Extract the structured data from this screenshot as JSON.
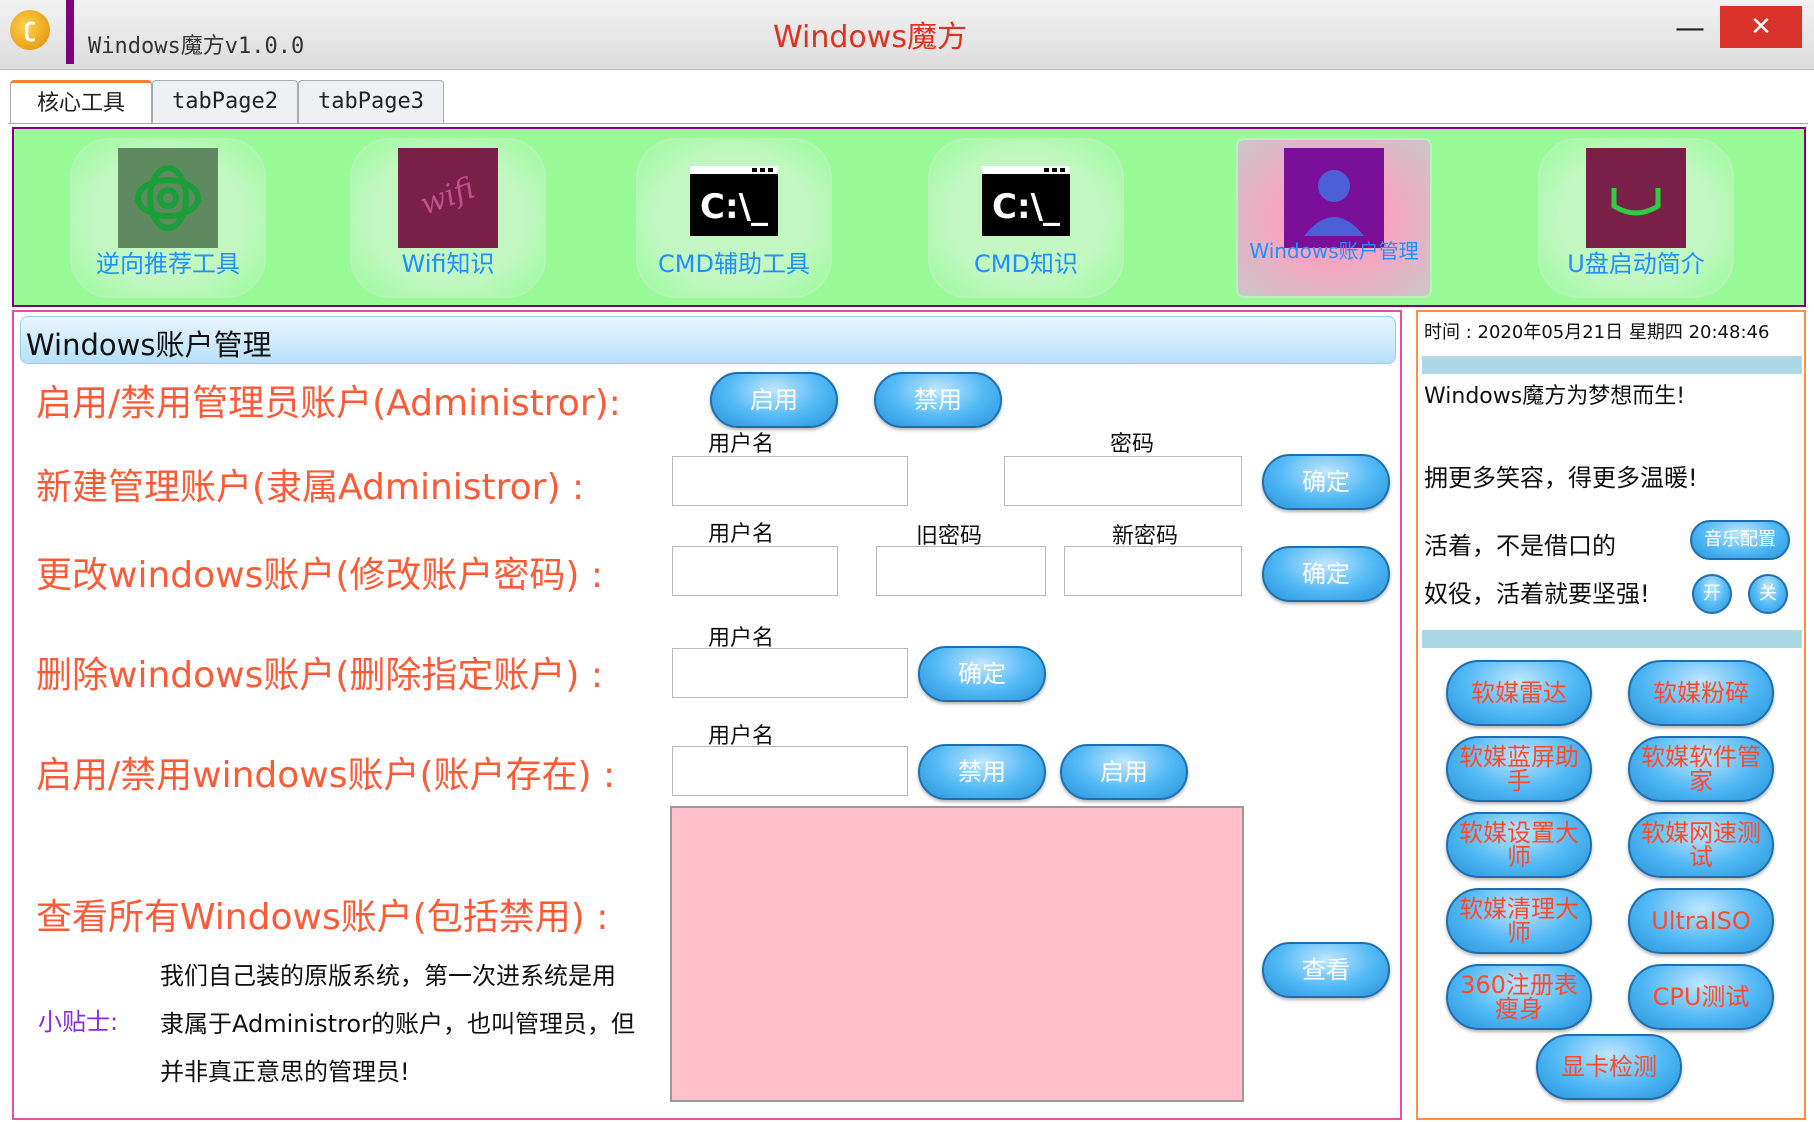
{
  "window": {
    "title_small": "Windows魔方v1.0.0",
    "title_center": "Windows魔方",
    "minimize": "—",
    "close": "✕"
  },
  "tabs": [
    "核心工具",
    "tabPage2",
    "tabPage3"
  ],
  "tools": [
    {
      "label": "逆向推荐工具",
      "icon": "reverse-icon"
    },
    {
      "label": "Wifi知识",
      "icon": "wifi-icon",
      "icon_text": "wifi"
    },
    {
      "label": "CMD辅助工具",
      "icon": "cmd-icon",
      "icon_text": "C:\\_"
    },
    {
      "label": "CMD知识",
      "icon": "cmd-icon",
      "icon_text": "C:\\_"
    },
    {
      "label": "Windows账户管理",
      "icon": "user-icon"
    },
    {
      "label": "U盘启动简介",
      "icon": "usb-icon"
    }
  ],
  "main": {
    "title": "Windows账户管理",
    "rows": {
      "admin_toggle": "启用/禁用管理员账户(Administror):",
      "new_admin": "新建管理账户(隶属Administror)  :",
      "change_pwd": "更改windows账户(修改账户密码) :",
      "delete_acct": "删除windows账户(删除指定账户) :",
      "toggle_acct": "启用/禁用windows账户(账户存在) :",
      "view_all": "查看所有Windows账户(包括禁用) :"
    },
    "labels": {
      "username": "用户名",
      "password": "密码",
      "old_password": "旧密码",
      "new_password": "新密码"
    },
    "buttons": {
      "enable": "启用",
      "disable": "禁用",
      "confirm": "确定",
      "view": "查看"
    },
    "tip_label": "小贴士:",
    "tip_lines": [
      "我们自己装的原版系统，第一次进系统是用",
      "隶属于Administror的账户，也叫管理员，但",
      "并非真正意思的管理员!"
    ]
  },
  "side": {
    "time": "时间 : 2020年05月21日 星期四 20:48:46",
    "slogan1": "Windows魔方为梦想而生!",
    "slogan2": "拥更多笑容，得更多温暖!",
    "slogan3": "活着，不是借口的",
    "slogan4": "奴役，活着就要坚强!",
    "music_config": "音乐配置",
    "music_on": "开",
    "music_off": "关",
    "software": [
      "软媒雷达",
      "软媒粉碎",
      "软媒蓝屏助手",
      "软媒软件管家",
      "软媒设置大师",
      "软媒网速测试",
      "软媒清理大师",
      "UltraISO",
      "360注册表瘦身",
      "CPU测试",
      "显卡检测"
    ]
  },
  "colors": {
    "toolbar_bg": "#98fb98",
    "accent_border": "#800080",
    "row_label": "#ff5a36",
    "output_bg": "#ffc0cb"
  }
}
